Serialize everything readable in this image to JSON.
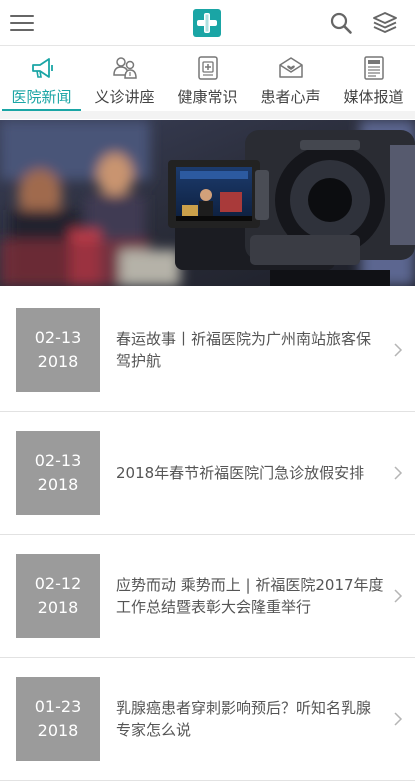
{
  "header": {
    "menu_icon": "hamburger-menu-icon",
    "logo_icon": "medical-cross-logo",
    "search_icon": "search-icon",
    "layers_icon": "layers-icon",
    "brand_color": "#1aa5a5"
  },
  "tabs": [
    {
      "label": "医院新闻",
      "icon": "megaphone-icon",
      "active": true
    },
    {
      "label": "义诊讲座",
      "icon": "doctors-icon",
      "active": false
    },
    {
      "label": "健康常识",
      "icon": "health-card-icon",
      "active": false
    },
    {
      "label": "患者心声",
      "icon": "envelope-heart-icon",
      "active": false
    },
    {
      "label": "媒体报道",
      "icon": "newspaper-icon",
      "active": false
    }
  ],
  "banner": {
    "image": "news-video-camera-photo"
  },
  "news": [
    {
      "month_day": "02-13",
      "year": "2018",
      "title": "春运故事丨祈福医院为广州南站旅客保驾护航"
    },
    {
      "month_day": "02-13",
      "year": "2018",
      "title": "2018年春节祈福医院门急诊放假安排"
    },
    {
      "month_day": "02-12",
      "year": "2018",
      "title": "应势而动 乘势而上 | 祈福医院2017年度工作总结暨表彰大会隆重举行"
    },
    {
      "month_day": "01-23",
      "year": "2018",
      "title": "乳腺癌患者穿刺影响预后？听知名乳腺专家怎么说"
    }
  ],
  "colors": {
    "accent": "#1aa5a5",
    "date_box": "#9b9b9b"
  }
}
